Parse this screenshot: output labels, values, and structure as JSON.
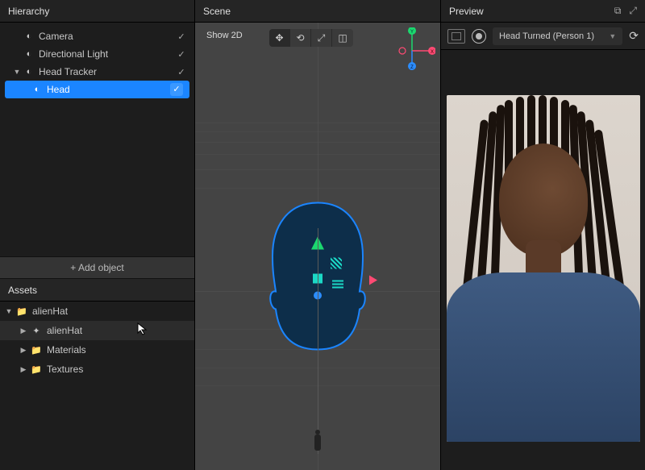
{
  "panels": {
    "hierarchy": {
      "title": "Hierarchy"
    },
    "scene": {
      "title": "Scene",
      "show2d": "Show 2D"
    },
    "preview": {
      "title": "Preview",
      "source": "Head Turned (Person 1)"
    },
    "assets": {
      "title": "Assets"
    }
  },
  "hierarchy_items": [
    {
      "label": "Camera",
      "checked": true
    },
    {
      "label": "Directional Light",
      "checked": true
    },
    {
      "label": "Head Tracker",
      "checked": true,
      "expandable": true
    },
    {
      "label": "Head",
      "checked": true,
      "selected": true
    }
  ],
  "add_object_label": "+ Add object",
  "assets_items": [
    {
      "label": "alienHat",
      "icon": "folder",
      "expandable": true,
      "depth": 0,
      "expanded": true
    },
    {
      "label": "alienHat",
      "icon": "object",
      "expandable": true,
      "depth": 1,
      "hover": true
    },
    {
      "label": "Materials",
      "icon": "folder",
      "expandable": true,
      "depth": 1
    },
    {
      "label": "Textures",
      "icon": "folder",
      "expandable": true,
      "depth": 1
    }
  ],
  "gizmo_axes": {
    "x": "X",
    "y": "Y",
    "z": "Z"
  }
}
